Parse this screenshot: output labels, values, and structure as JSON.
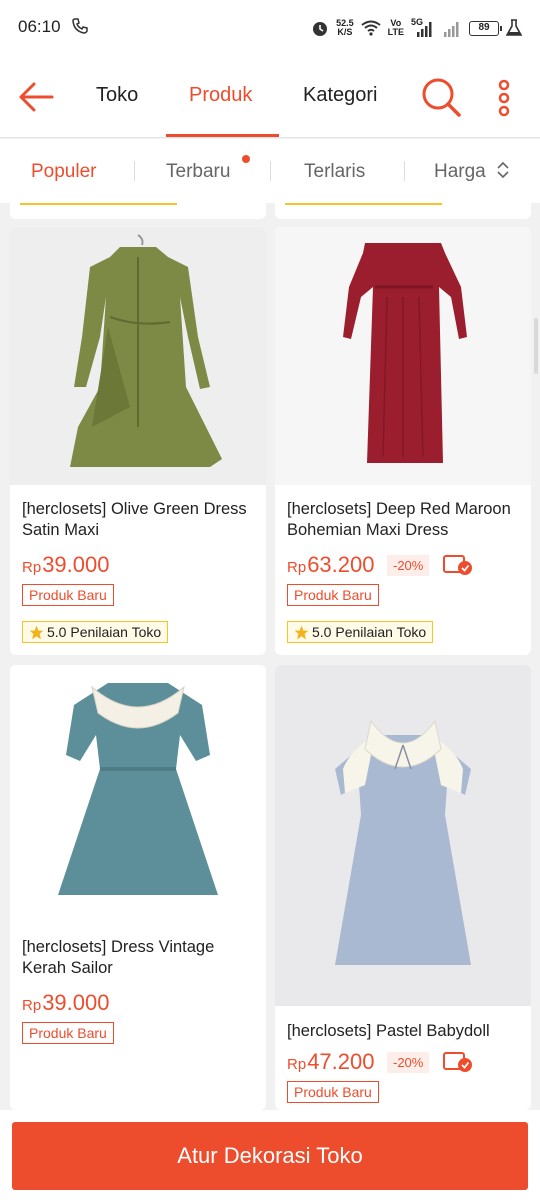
{
  "status_bar": {
    "time": "06:10",
    "speed": "52.5",
    "speed_unit": "K/S",
    "volte": "Vo",
    "volte2": "LTE",
    "network": "5G",
    "battery": "89"
  },
  "header": {
    "tabs": [
      {
        "label": "Toko",
        "active": false
      },
      {
        "label": "Produk",
        "active": true
      },
      {
        "label": "Kategori",
        "active": false
      }
    ]
  },
  "sort": {
    "items": [
      {
        "label": "Populer",
        "active": true
      },
      {
        "label": "Terbaru",
        "active": false,
        "dot": true
      },
      {
        "label": "Terlaris",
        "active": false
      },
      {
        "label": "Harga",
        "active": false
      }
    ]
  },
  "products": [
    {
      "title": "[herclosets] Olive Green Dress Satin Maxi",
      "currency": "Rp",
      "price": "39.000",
      "badge": "Produk Baru",
      "rating": "5.0 Penilaian Toko"
    },
    {
      "title": "[herclosets] Deep Red Maroon Bohemian Maxi Dress",
      "currency": "Rp",
      "price": "63.200",
      "discount": "-20%",
      "badge": "Produk Baru",
      "rating": "5.0 Penilaian Toko"
    },
    {
      "title": "[herclosets] Dress Vintage Kerah Sailor",
      "currency": "Rp",
      "price": "39.000",
      "badge": "Produk Baru"
    },
    {
      "title": "[herclosets] Pastel Babydoll",
      "currency": "Rp",
      "price": "47.200",
      "discount": "-20%",
      "badge": "Produk Baru"
    }
  ],
  "colors": {
    "accent": "#ee4d2d",
    "rating_border": "#f3c42c"
  },
  "cta": {
    "label": "Atur Dekorasi Toko"
  }
}
